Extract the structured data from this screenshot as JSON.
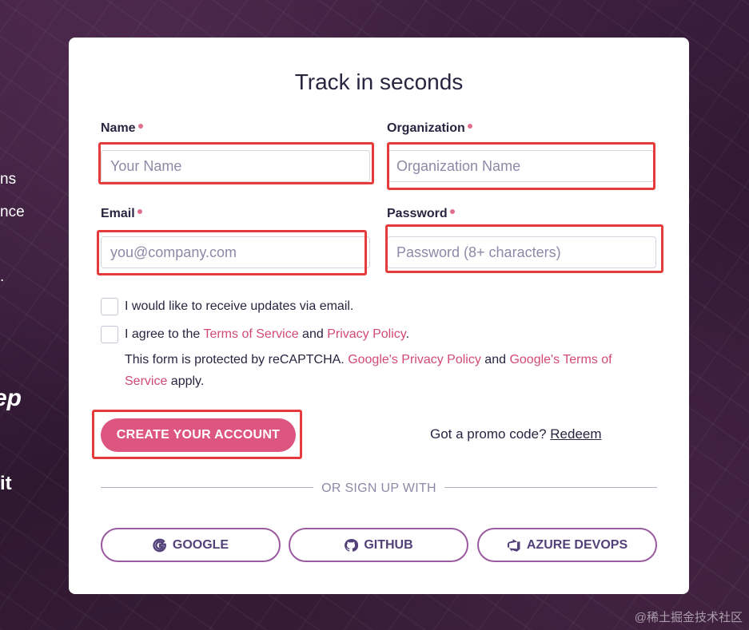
{
  "background_fragments": [
    "ns",
    "nce",
    ".",
    "ep",
    "it"
  ],
  "form": {
    "title": "Track in seconds",
    "name": {
      "label": "Name",
      "placeholder": "Your Name"
    },
    "organization": {
      "label": "Organization",
      "placeholder": "Organization Name"
    },
    "email": {
      "label": "Email",
      "placeholder": "you@company.com"
    },
    "password": {
      "label": "Password",
      "placeholder": "Password (8+ characters)"
    },
    "updates_checkbox": {
      "label": "I would like to receive updates via email."
    },
    "terms_checkbox": {
      "prefix": "I agree to the ",
      "terms_link": "Terms of Service",
      "and": " and ",
      "privacy_link": "Privacy Policy",
      "suffix": "."
    },
    "recaptcha": {
      "prefix": "This form is protected by reCAPTCHA. ",
      "privacy_link": "Google's Privacy Policy",
      "and": " and ",
      "terms_link": "Google's Terms of Service",
      "suffix": " apply."
    },
    "create_button": "CREATE YOUR ACCOUNT",
    "promo": {
      "text": "Got a promo code? ",
      "link": "Redeem"
    },
    "divider": "OR SIGN UP WITH",
    "social": [
      {
        "label": "GOOGLE",
        "icon": "google-icon"
      },
      {
        "label": "GITHUB",
        "icon": "github-icon"
      },
      {
        "label": "AZURE DEVOPS",
        "icon": "azure-devops-icon"
      }
    ]
  },
  "watermark": "@稀土掘金技术社区",
  "colors": {
    "accent": "#dd5680",
    "link": "#d24a73",
    "highlight": "#e53b3b",
    "social_border": "#9a5a9f"
  }
}
